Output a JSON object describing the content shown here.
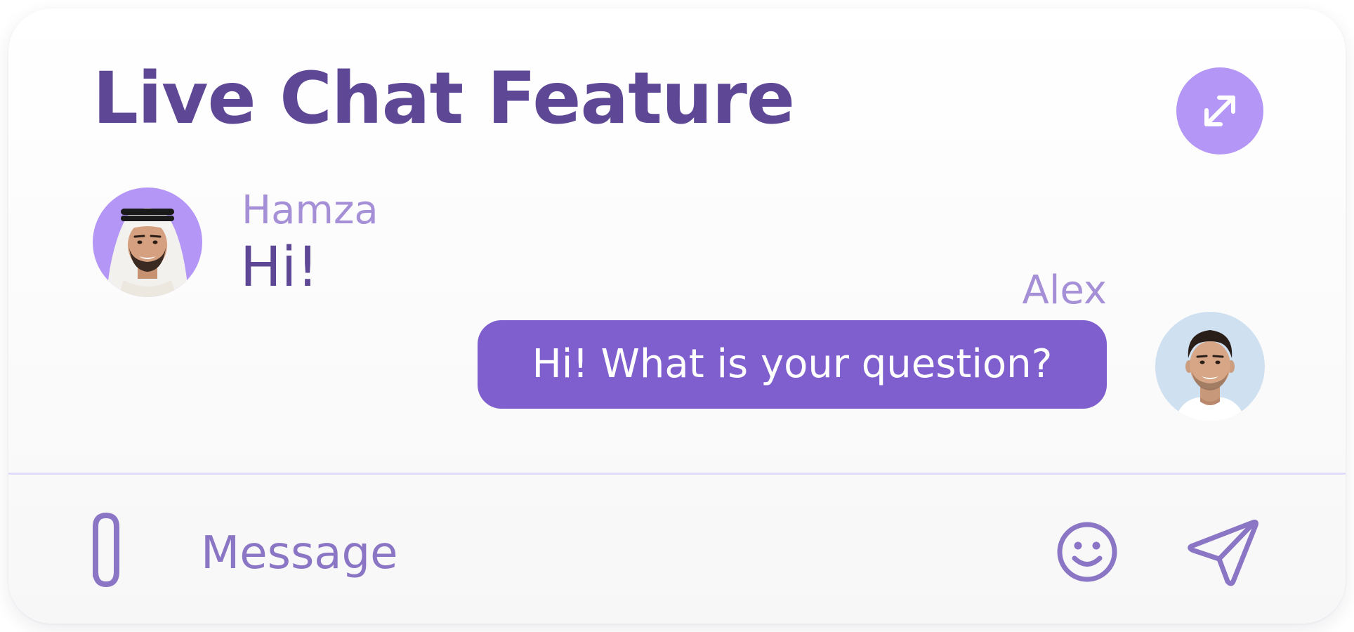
{
  "colors": {
    "title": "#5e4896",
    "accent": "#b496f6",
    "bubble": "#7f5fcd",
    "sender_name": "#a58fd6",
    "icon": "#8a76c4",
    "divider": "#e3dcf8"
  },
  "header": {
    "title": "Live Chat Feature",
    "expand_icon": "expand-diagonal-arrows-icon"
  },
  "messages": [
    {
      "sender": "Hamza",
      "text": "Hi!",
      "direction": "incoming",
      "avatar": "avatar-photo-hamza"
    },
    {
      "sender": "Alex",
      "text": "Hi! What is your question?",
      "direction": "outgoing",
      "avatar": "avatar-photo-alex"
    }
  ],
  "composer": {
    "placeholder": "Message",
    "value": "",
    "attach_icon": "paperclip-icon",
    "emoji_icon": "smiley-face-icon",
    "send_icon": "paper-plane-send-icon"
  }
}
